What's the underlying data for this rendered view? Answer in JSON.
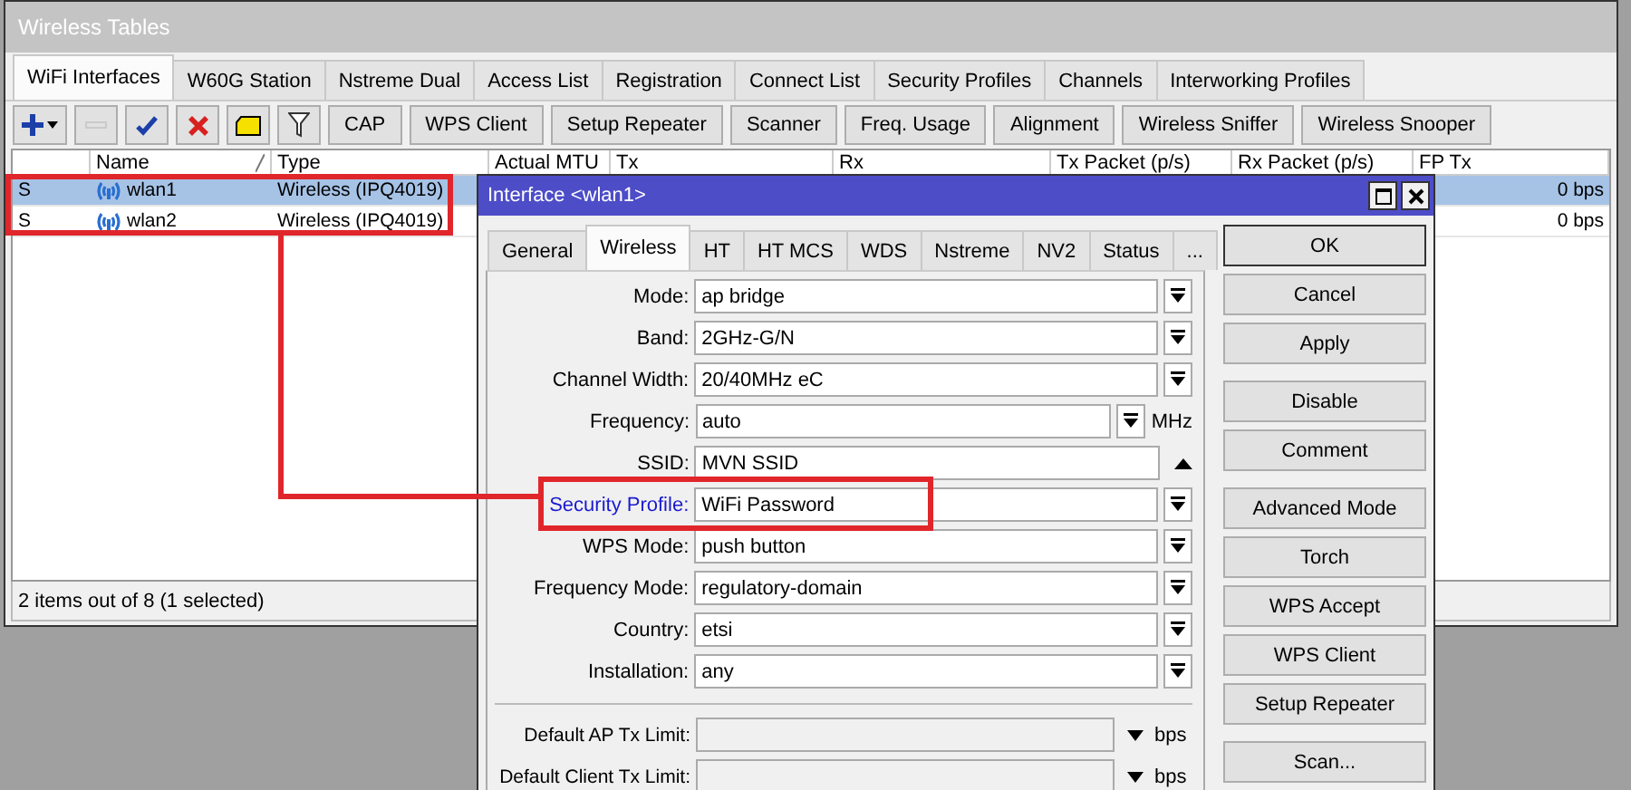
{
  "window": {
    "title": "Wireless Tables"
  },
  "tabs": [
    {
      "label": "WiFi Interfaces",
      "selected": true
    },
    {
      "label": "W60G Station",
      "selected": false
    },
    {
      "label": "Nstreme Dual",
      "selected": false
    },
    {
      "label": "Access List",
      "selected": false
    },
    {
      "label": "Registration",
      "selected": false
    },
    {
      "label": "Connect List",
      "selected": false
    },
    {
      "label": "Security Profiles",
      "selected": false
    },
    {
      "label": "Channels",
      "selected": false
    },
    {
      "label": "Interworking Profiles",
      "selected": false
    }
  ],
  "toolbar": {
    "icon_buttons": [
      {
        "kind": "add",
        "disabled": false
      },
      {
        "kind": "remove",
        "disabled": true
      },
      {
        "kind": "enable",
        "disabled": false
      },
      {
        "kind": "disable",
        "disabled": false
      },
      {
        "kind": "comment",
        "disabled": false
      },
      {
        "kind": "filter",
        "disabled": false
      }
    ],
    "buttons": [
      "CAP",
      "WPS Client",
      "Setup Repeater",
      "Scanner",
      "Freq. Usage",
      "Alignment",
      "Wireless Sniffer",
      "Wireless Snooper"
    ]
  },
  "table": {
    "columns": [
      {
        "sorted": false
      },
      {
        "label": "Name",
        "sorted": true
      },
      {
        "label": "Type",
        "sorted": false
      },
      {
        "label": "Actual MTU",
        "sorted": false
      },
      {
        "label": "Tx",
        "sorted": false
      },
      {
        "label": "Rx",
        "sorted": false
      },
      {
        "label": "Tx Packet (p/s)",
        "sorted": false
      },
      {
        "label": "Rx Packet (p/s)",
        "sorted": false
      },
      {
        "label": "FP Tx",
        "sorted": false
      }
    ],
    "rows": [
      {
        "flag": "S",
        "name": "wlan1",
        "type": "Wireless (IPQ4019)",
        "fp_tx": "0 bps",
        "selected": true
      },
      {
        "flag": "S",
        "name": "wlan2",
        "type": "Wireless (IPQ4019)",
        "fp_tx": "0 bps",
        "selected": false
      }
    ]
  },
  "status_bar": "2 items out of 8 (1 selected)",
  "dialog": {
    "title": "Interface <wlan1>",
    "tabs": [
      {
        "label": "General",
        "selected": false
      },
      {
        "label": "Wireless",
        "selected": true
      },
      {
        "label": "HT",
        "selected": false
      },
      {
        "label": "HT MCS",
        "selected": false
      },
      {
        "label": "WDS",
        "selected": false
      },
      {
        "label": "Nstreme",
        "selected": false
      },
      {
        "label": "NV2",
        "selected": false
      },
      {
        "label": "Status",
        "selected": false
      },
      {
        "label": "...",
        "selected": false
      }
    ],
    "fields": [
      {
        "kind": "select",
        "label": "Mode:",
        "value": "ap bridge",
        "highlighted": false
      },
      {
        "kind": "select",
        "label": "Band:",
        "value": "2GHz-G/N",
        "highlighted": false
      },
      {
        "kind": "select",
        "label": "Channel Width:",
        "value": "20/40MHz eC",
        "highlighted": false
      },
      {
        "kind": "select_unit",
        "label": "Frequency:",
        "value": "auto",
        "unit": "MHz",
        "highlighted": false
      },
      {
        "kind": "text",
        "label": "SSID:",
        "value": "MVN SSID",
        "highlighted": false
      },
      {
        "kind": "select",
        "label": "Security Profile:",
        "value": "WiFi Password",
        "highlighted": true
      },
      {
        "kind": "select",
        "label": "WPS Mode:",
        "value": "push button",
        "highlighted": false
      },
      {
        "kind": "select",
        "label": "Frequency Mode:",
        "value": "regulatory-domain",
        "highlighted": false
      },
      {
        "kind": "select",
        "label": "Country:",
        "value": "etsi",
        "highlighted": false
      },
      {
        "kind": "select",
        "label": "Installation:",
        "value": "any",
        "highlighted": false
      }
    ],
    "limit_fields": [
      {
        "kind": "limit",
        "label": "Default AP Tx Limit:",
        "unit": "bps",
        "highlighted": false
      },
      {
        "kind": "limit",
        "label": "Default Client Tx Limit:",
        "unit": "bps",
        "highlighted": false
      }
    ],
    "button_groups": [
      [
        {
          "label": "OK",
          "default": true
        },
        {
          "label": "Cancel",
          "default": false
        },
        {
          "label": "Apply",
          "default": false
        }
      ],
      [
        {
          "label": "Disable",
          "default": false
        },
        {
          "label": "Comment",
          "default": false
        }
      ],
      [
        {
          "label": "Advanced Mode",
          "default": false
        },
        {
          "label": "Torch",
          "default": false
        },
        {
          "label": "WPS Accept",
          "default": false
        },
        {
          "label": "WPS Client",
          "default": false
        },
        {
          "label": "Setup Repeater",
          "default": false
        }
      ],
      [
        {
          "label": "Scan...",
          "default": false
        }
      ]
    ]
  }
}
